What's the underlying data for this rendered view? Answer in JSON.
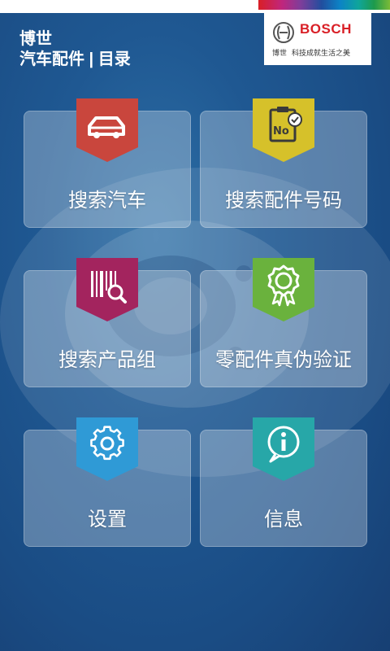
{
  "header": {
    "title_line1": "博世",
    "title_line2": "汽车配件 | 目录"
  },
  "logo": {
    "brand": "BOSCH",
    "sub_left": "博世",
    "sub_right": "科技成就生活之美"
  },
  "menu": [
    {
      "label": "搜索汽车",
      "icon": "car-icon",
      "color": "#c9463d"
    },
    {
      "label": "搜索配件号码",
      "icon": "clipboard-no-icon",
      "color": "#d6c12a"
    },
    {
      "label": "搜索产品组",
      "icon": "barcode-magnifier-icon",
      "color": "#a3245e"
    },
    {
      "label": "零配件真伪验证",
      "icon": "seal-certificate-icon",
      "color": "#6ab23d"
    },
    {
      "label": "设置",
      "icon": "gear-icon",
      "color": "#2f9ad6"
    },
    {
      "label": "信息",
      "icon": "info-icon",
      "color": "#27a7a8"
    }
  ],
  "colors": {
    "background": "#1f5892",
    "brand_red": "#d91f26"
  }
}
